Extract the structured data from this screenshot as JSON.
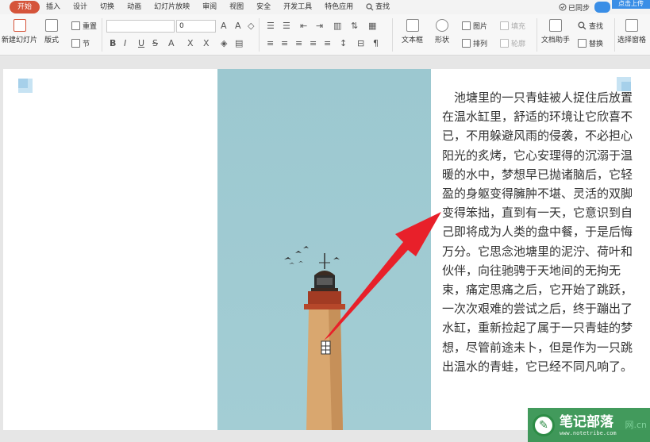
{
  "menu": {
    "items": [
      "开始",
      "插入",
      "设计",
      "切换",
      "动画",
      "幻灯片放映",
      "审阅",
      "视图",
      "安全",
      "开发工具",
      "特色应用"
    ],
    "search": "查找",
    "sync": "已同步",
    "upload": "点击上传"
  },
  "ribbon": {
    "new_slide": "新建幻灯片",
    "layout": "版式",
    "reset": "重置",
    "section": "节",
    "font_size": "0",
    "textbox": "文本框",
    "shape": "形状",
    "picture": "图片",
    "fill": "填充",
    "arrange": "排列",
    "outline": "轮廓",
    "doc_assistant": "文档助手",
    "find": "查找",
    "replace": "替换",
    "select_pane": "选择窗格"
  },
  "slide": {
    "text": "　池塘里的一只青蛙被人捉住后放置在温水缸里，舒适的环境让它欣喜不已，不用躲避风雨的侵袭，不必担心阳光的炙烤，它心安理得的沉溺于温暖的水中，梦想早已抛诸脑后，它轻盈的身躯变得臃肿不堪、灵活的双脚变得笨拙，直到有一天，它意识到自己即将成为人类的盘中餐，于是后悔万分。它思念池塘里的泥泞、荷叶和伙伴，向往驰骋于天地间的无拘无束，痛定思痛之后，它开始了跳跃，一次次艰难的尝试之后，终于蹦出了水缸，重新捡起了属于一只青蛙的梦想，尽管前途未卜，但是作为一只跳出温水的青蛙，它已经不同凡响了。"
  },
  "watermark": {
    "title": "笔记部落",
    "url": "www.notetribe.com",
    "suffix": "网.cn"
  },
  "colors": {
    "accent": "#d5543a",
    "sky": "#9fcad2",
    "arrow": "#e8202a"
  }
}
